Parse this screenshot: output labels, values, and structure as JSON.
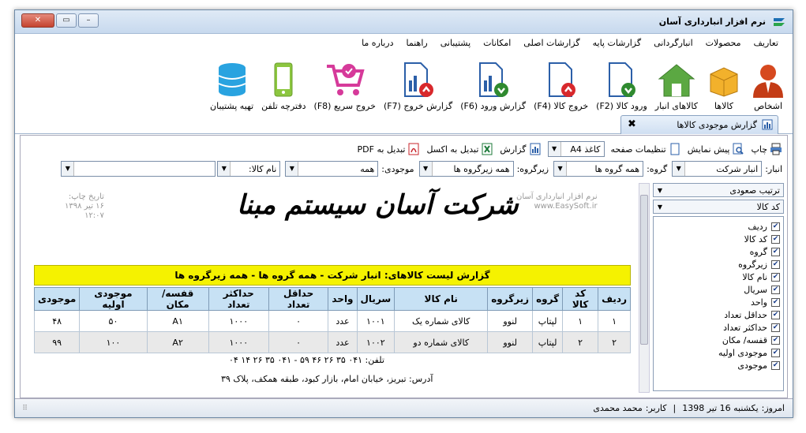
{
  "window": {
    "title": "نرم افزار انبارداری آسان"
  },
  "menu": [
    "تعاریف",
    "محصولات",
    "انبارگردانی",
    "گزارشات پایه",
    "گزارشات اصلی",
    "امکانات",
    "پشتیبانی",
    "راهنما",
    "درباره ما"
  ],
  "toolbar": [
    {
      "label": "اشخاص",
      "icon": "person-icon"
    },
    {
      "label": "کالاها",
      "icon": "box-icon"
    },
    {
      "label": "کالاهای انبار",
      "icon": "warehouse-icon"
    },
    {
      "label": "ورود کالا (F2)",
      "icon": "goods-in-icon"
    },
    {
      "label": "خروج کالا (F4)",
      "icon": "goods-out-icon"
    },
    {
      "label": "گزارش ورود (F6)",
      "icon": "report-in-icon"
    },
    {
      "label": "گزارش خروج (F7)",
      "icon": "report-out-icon"
    },
    {
      "label": "خروج سریع (F8)",
      "icon": "quick-exit-cart-icon"
    },
    {
      "label": "دفترچه تلفن",
      "icon": "phone-icon"
    },
    {
      "label": "تهیه پشتیبان",
      "icon": "database-icon"
    }
  ],
  "tab": {
    "label": "گزارش موجودی کالاها",
    "close": "✖"
  },
  "report_tools": {
    "print": "چاپ",
    "preview": "پیش نمایش",
    "page_setup": "تنظیمات صفحه",
    "paper_size": "کاغذ A4",
    "report": "گزارش",
    "to_excel": "تبدیل به اکسل",
    "to_pdf": "تبدیل به PDF"
  },
  "filters": {
    "warehouse_label": "انبار:",
    "warehouse_value": "انبار شرکت",
    "group_label": "گروه:",
    "group_value": "همه گروه ها",
    "subgroup_label": "زیرگروه:",
    "subgroup_value": "همه زیرگروه ها",
    "stock_label": "موجودی:",
    "stock_value": "همه",
    "item_name_label": "نام کالا:",
    "item_name_value": ""
  },
  "sidepanel": {
    "sort_order": "ترتیب صعودی",
    "sort_field": "کد کالا",
    "columns": [
      "ردیف",
      "کد کالا",
      "گروه",
      "زیرگروه",
      "نام کالا",
      "سریال",
      "واحد",
      "حداقل تعداد",
      "حداکثر تعداد",
      "قفسه/ مکان",
      "موجودی اولیه",
      "موجودی"
    ]
  },
  "report": {
    "software_line1": "نرم افزار انبارداری آسان",
    "software_line2": "www.EasySoft.ir",
    "print_date_label": "تاریخ چاپ:",
    "print_date": "۱۶ تیر ۱۳۹۸",
    "print_time": "۱۲:۰۷",
    "brand": "شرکت آسان سیستم مبنا",
    "title": "گزارش لیست کالاهای: انبار شرکت - همه گروه ها - همه زیرگروه ها",
    "headers": [
      "ردیف",
      "کد کالا",
      "گروه",
      "زیرگروه",
      "نام کالا",
      "سریال",
      "واحد",
      "حداقل تعداد",
      "حداکثر تعداد",
      "قفسه/ مکان",
      "موجودی اولیه",
      "موجودی"
    ],
    "rows": [
      [
        "۱",
        "۱",
        "لپتاپ",
        "لنوو",
        "کالای شماره یک",
        "۱۰۰۱",
        "عدد",
        "۰",
        "۱۰۰۰",
        "A۱",
        "۵۰",
        "۴۸"
      ],
      [
        "۲",
        "۲",
        "لپتاپ",
        "لنوو",
        "کالای شماره دو",
        "۱۰۰۲",
        "عدد",
        "۰",
        "۱۰۰۰",
        "A۲",
        "۱۰۰",
        "۹۹"
      ]
    ],
    "phone": "تلفن: ۰۴۱ ۳۵ ۲۶ ۴۶ ۵۹ - ۰۴۱ ۳۵ ۲۶ ۱۴ ۰۴",
    "address": "آدرس: تبریز، خیابان امام، بازار کبود، طبقه همکف، پلاک ۳۹"
  },
  "status": {
    "today_label": "امروز:",
    "today": "یکشنبه 16 تیر 1398",
    "user_label": "کاربر:",
    "user": "محمد محمدی"
  },
  "colors": {
    "title_bar": "#d6e4f3",
    "report_title_bg": "#f5f200",
    "header_bg": "#c7e1f4"
  }
}
